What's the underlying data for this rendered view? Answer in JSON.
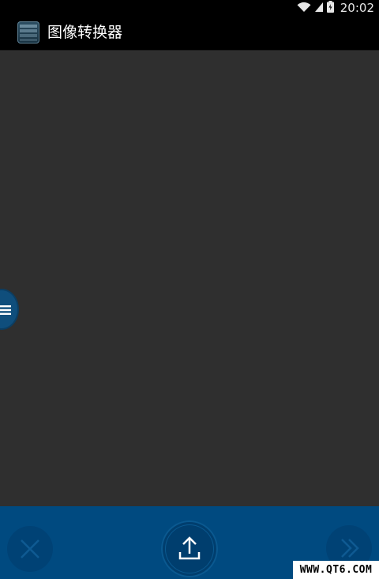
{
  "status_bar": {
    "time": "20:02",
    "icons": [
      "wifi-icon",
      "cell-signal-icon",
      "battery-icon"
    ]
  },
  "action_bar": {
    "title": "图像转换器",
    "app_icon": "image-converter-app-icon"
  },
  "drawer": {
    "icon": "menu-icon"
  },
  "bottom_bar": {
    "cancel_icon": "close-icon",
    "upload_icon": "upload-icon",
    "next_icon": "double-chevron-right-icon"
  },
  "watermark": {
    "text": "WWW.QT6.COM"
  },
  "colors": {
    "canvas": "#2f2f2f",
    "bars": "#000000",
    "accent": "#004a80",
    "button": "#004275"
  }
}
